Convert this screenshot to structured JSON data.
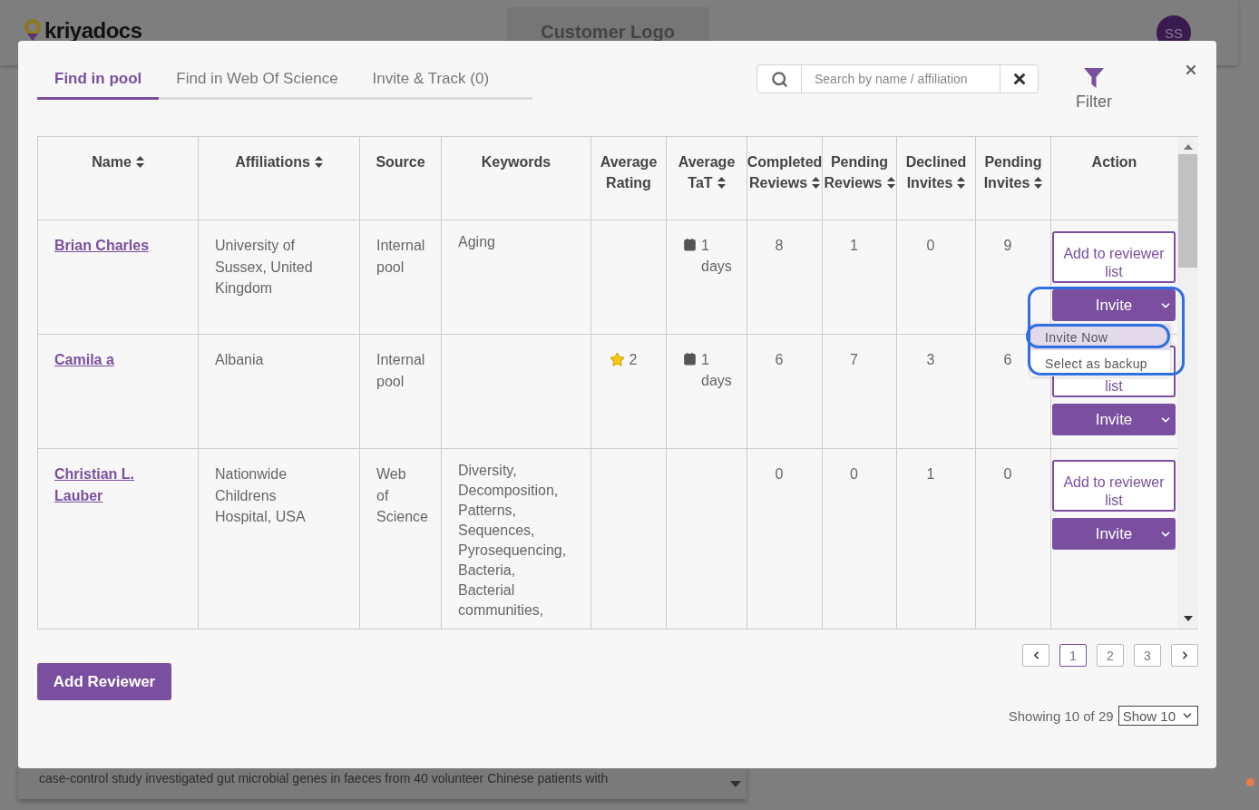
{
  "background": {
    "logo": "kriyadocs",
    "customer_logo": "Customer Logo",
    "avatar": "SS",
    "abstract": [
      "case-control study investigated gut microbial genes in faeces from 40 volunteer Chinese patients with"
    ]
  },
  "tabs": [
    {
      "label": "Find in pool",
      "selected": true
    },
    {
      "label": "Find in Web Of Science",
      "selected": false
    },
    {
      "label": "Invite & Track (0)",
      "selected": false
    }
  ],
  "search": {
    "placeholder": "Search by name / affiliation"
  },
  "filter": {
    "label": "Filter"
  },
  "table": {
    "columns": [
      {
        "label": "Name",
        "sortable": true
      },
      {
        "label": "Affiliations",
        "sortable": true
      },
      {
        "label": "Source",
        "sortable": false
      },
      {
        "label": "Keywords",
        "sortable": false
      },
      {
        "label": "Average Rating",
        "sortable": false
      },
      {
        "label": "Average TaT",
        "sortable": true
      },
      {
        "label": "Completed Reviews",
        "sortable": true
      },
      {
        "label": "Pending Reviews",
        "sortable": true
      },
      {
        "label": "Declined Invites",
        "sortable": true
      },
      {
        "label": "Pending Invites",
        "sortable": true
      },
      {
        "label": "Action",
        "sortable": false
      }
    ],
    "rows": [
      {
        "name": "Brian Charles",
        "affiliation": "University of Sussex, United Kingdom",
        "source": "Internal pool",
        "keywords": "Aging",
        "tat": "1 days",
        "completed": "8",
        "pending_reviews": "1",
        "declined": "0",
        "pending_invites": "9",
        "add_label": "Add to reviewer list",
        "invite_label": "Invite"
      },
      {
        "name": "Camila a",
        "affiliation": "Albania",
        "source": "Internal pool",
        "rating": "2",
        "tat": "1 days",
        "completed": "6",
        "pending_reviews": "7",
        "declined": "3",
        "pending_invites": "6",
        "add_label": "list",
        "invite_label": "Invite"
      },
      {
        "name": "Christian L. Lauber",
        "affiliation": "Nationwide Childrens Hospital, USA",
        "source": "Web of Science",
        "keywords": "Diversity, Decomposition, Patterns, Sequences, Pyrosequencing, Bacteria, Bacterial communities,",
        "completed": "0",
        "pending_reviews": "0",
        "declined": "1",
        "pending_invites": "0",
        "add_label": "Add to reviewer list",
        "invite_label": "Invite"
      }
    ]
  },
  "invite_menu": {
    "items": [
      {
        "label": "Invite Now",
        "selected": true
      },
      {
        "label": "Select as backup",
        "selected": false
      }
    ]
  },
  "add_reviewer": "Add Reviewer",
  "pagination": {
    "pages": [
      {
        "label": "1",
        "selected": true
      },
      {
        "label": "2",
        "selected": false
      },
      {
        "label": "3",
        "selected": false
      }
    ]
  },
  "showing": "Showing 10 of 29",
  "page_size": "Show 10"
}
